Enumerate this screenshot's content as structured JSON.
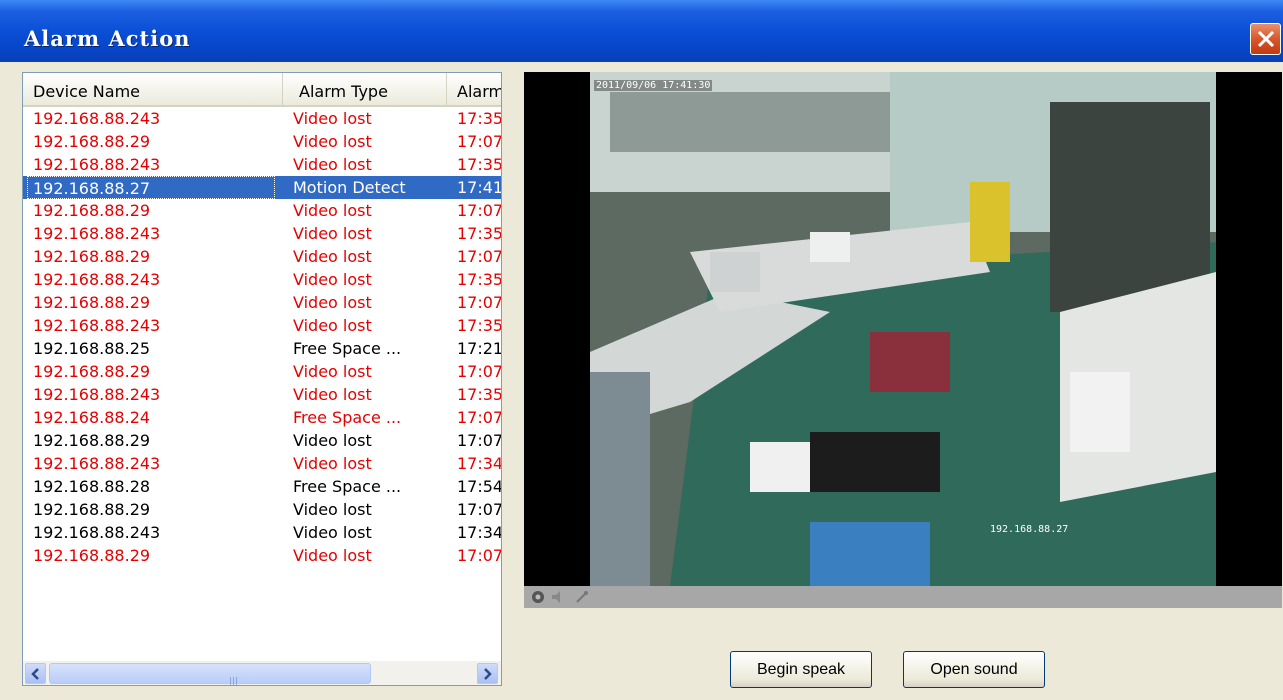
{
  "window": {
    "title": "Alarm Action"
  },
  "columns": [
    "Device Name",
    "Alarm Type",
    "Alarm"
  ],
  "rows": [
    {
      "device": "192.168.88.243",
      "type": "Video lost",
      "time": "17:35",
      "color": "#e60000"
    },
    {
      "device": "192.168.88.29",
      "type": "Video lost",
      "time": "17:07",
      "color": "#e60000"
    },
    {
      "device": "192.168.88.243",
      "type": "Video lost",
      "time": "17:35",
      "color": "#e60000"
    },
    {
      "device": "192.168.88.27",
      "type": "Motion Detect",
      "time": "17:41",
      "color": "#ffffff",
      "selected": true
    },
    {
      "device": "192.168.88.29",
      "type": "Video lost",
      "time": "17:07",
      "color": "#e60000"
    },
    {
      "device": "192.168.88.243",
      "type": "Video lost",
      "time": "17:35",
      "color": "#e60000"
    },
    {
      "device": "192.168.88.29",
      "type": "Video lost",
      "time": "17:07",
      "color": "#e60000"
    },
    {
      "device": "192.168.88.243",
      "type": "Video lost",
      "time": "17:35",
      "color": "#e60000"
    },
    {
      "device": "192.168.88.29",
      "type": "Video lost",
      "time": "17:07",
      "color": "#e60000"
    },
    {
      "device": "192.168.88.243",
      "type": "Video lost",
      "time": "17:35",
      "color": "#e60000"
    },
    {
      "device": "192.168.88.25",
      "type": "Free Space ...",
      "time": "17:21",
      "color": "#000000"
    },
    {
      "device": "192.168.88.29",
      "type": "Video lost",
      "time": "17:07",
      "color": "#e60000"
    },
    {
      "device": "192.168.88.243",
      "type": "Video lost",
      "time": "17:35",
      "color": "#e60000"
    },
    {
      "device": "192.168.88.24",
      "type": "Free Space ...",
      "time": "17:07",
      "color": "#e60000"
    },
    {
      "device": "192.168.88.29",
      "type": "Video lost",
      "time": "17:07",
      "color": "#000000"
    },
    {
      "device": "192.168.88.243",
      "type": "Video lost",
      "time": "17:34",
      "color": "#e60000"
    },
    {
      "device": "192.168.88.28",
      "type": "Free Space ...",
      "time": "17:54",
      "color": "#000000"
    },
    {
      "device": "192.168.88.29",
      "type": "Video lost",
      "time": "17:07",
      "color": "#000000"
    },
    {
      "device": "192.168.88.243",
      "type": "Video lost",
      "time": "17:34",
      "color": "#000000"
    },
    {
      "device": "192.168.88.29",
      "type": "Video lost",
      "time": "17:07",
      "color": "#e60000"
    }
  ],
  "video": {
    "timestamp": "2011/09/06 17:41:30",
    "camera_ip": "192.168.88.27"
  },
  "buttons": {
    "speak": "Begin speak",
    "sound": "Open sound"
  },
  "colors": {
    "titlebar": "#0a4fd6",
    "alarm_red": "#e60000",
    "selection": "#316ac5",
    "close": "#d7572b"
  }
}
